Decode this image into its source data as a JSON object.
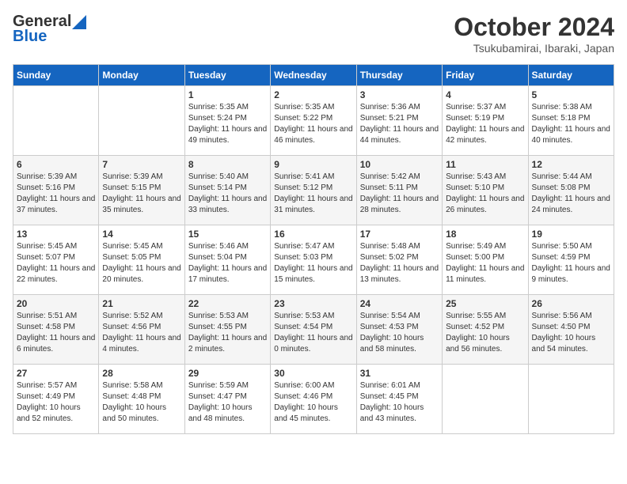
{
  "header": {
    "logo_general": "General",
    "logo_blue": "Blue",
    "month_title": "October 2024",
    "location": "Tsukubamirai, Ibaraki, Japan"
  },
  "days_of_week": [
    "Sunday",
    "Monday",
    "Tuesday",
    "Wednesday",
    "Thursday",
    "Friday",
    "Saturday"
  ],
  "weeks": [
    [
      {
        "day": "",
        "info": ""
      },
      {
        "day": "",
        "info": ""
      },
      {
        "day": "1",
        "info": "Sunrise: 5:35 AM\nSunset: 5:24 PM\nDaylight: 11 hours and 49 minutes."
      },
      {
        "day": "2",
        "info": "Sunrise: 5:35 AM\nSunset: 5:22 PM\nDaylight: 11 hours and 46 minutes."
      },
      {
        "day": "3",
        "info": "Sunrise: 5:36 AM\nSunset: 5:21 PM\nDaylight: 11 hours and 44 minutes."
      },
      {
        "day": "4",
        "info": "Sunrise: 5:37 AM\nSunset: 5:19 PM\nDaylight: 11 hours and 42 minutes."
      },
      {
        "day": "5",
        "info": "Sunrise: 5:38 AM\nSunset: 5:18 PM\nDaylight: 11 hours and 40 minutes."
      }
    ],
    [
      {
        "day": "6",
        "info": "Sunrise: 5:39 AM\nSunset: 5:16 PM\nDaylight: 11 hours and 37 minutes."
      },
      {
        "day": "7",
        "info": "Sunrise: 5:39 AM\nSunset: 5:15 PM\nDaylight: 11 hours and 35 minutes."
      },
      {
        "day": "8",
        "info": "Sunrise: 5:40 AM\nSunset: 5:14 PM\nDaylight: 11 hours and 33 minutes."
      },
      {
        "day": "9",
        "info": "Sunrise: 5:41 AM\nSunset: 5:12 PM\nDaylight: 11 hours and 31 minutes."
      },
      {
        "day": "10",
        "info": "Sunrise: 5:42 AM\nSunset: 5:11 PM\nDaylight: 11 hours and 28 minutes."
      },
      {
        "day": "11",
        "info": "Sunrise: 5:43 AM\nSunset: 5:10 PM\nDaylight: 11 hours and 26 minutes."
      },
      {
        "day": "12",
        "info": "Sunrise: 5:44 AM\nSunset: 5:08 PM\nDaylight: 11 hours and 24 minutes."
      }
    ],
    [
      {
        "day": "13",
        "info": "Sunrise: 5:45 AM\nSunset: 5:07 PM\nDaylight: 11 hours and 22 minutes."
      },
      {
        "day": "14",
        "info": "Sunrise: 5:45 AM\nSunset: 5:05 PM\nDaylight: 11 hours and 20 minutes."
      },
      {
        "day": "15",
        "info": "Sunrise: 5:46 AM\nSunset: 5:04 PM\nDaylight: 11 hours and 17 minutes."
      },
      {
        "day": "16",
        "info": "Sunrise: 5:47 AM\nSunset: 5:03 PM\nDaylight: 11 hours and 15 minutes."
      },
      {
        "day": "17",
        "info": "Sunrise: 5:48 AM\nSunset: 5:02 PM\nDaylight: 11 hours and 13 minutes."
      },
      {
        "day": "18",
        "info": "Sunrise: 5:49 AM\nSunset: 5:00 PM\nDaylight: 11 hours and 11 minutes."
      },
      {
        "day": "19",
        "info": "Sunrise: 5:50 AM\nSunset: 4:59 PM\nDaylight: 11 hours and 9 minutes."
      }
    ],
    [
      {
        "day": "20",
        "info": "Sunrise: 5:51 AM\nSunset: 4:58 PM\nDaylight: 11 hours and 6 minutes."
      },
      {
        "day": "21",
        "info": "Sunrise: 5:52 AM\nSunset: 4:56 PM\nDaylight: 11 hours and 4 minutes."
      },
      {
        "day": "22",
        "info": "Sunrise: 5:53 AM\nSunset: 4:55 PM\nDaylight: 11 hours and 2 minutes."
      },
      {
        "day": "23",
        "info": "Sunrise: 5:53 AM\nSunset: 4:54 PM\nDaylight: 11 hours and 0 minutes."
      },
      {
        "day": "24",
        "info": "Sunrise: 5:54 AM\nSunset: 4:53 PM\nDaylight: 10 hours and 58 minutes."
      },
      {
        "day": "25",
        "info": "Sunrise: 5:55 AM\nSunset: 4:52 PM\nDaylight: 10 hours and 56 minutes."
      },
      {
        "day": "26",
        "info": "Sunrise: 5:56 AM\nSunset: 4:50 PM\nDaylight: 10 hours and 54 minutes."
      }
    ],
    [
      {
        "day": "27",
        "info": "Sunrise: 5:57 AM\nSunset: 4:49 PM\nDaylight: 10 hours and 52 minutes."
      },
      {
        "day": "28",
        "info": "Sunrise: 5:58 AM\nSunset: 4:48 PM\nDaylight: 10 hours and 50 minutes."
      },
      {
        "day": "29",
        "info": "Sunrise: 5:59 AM\nSunset: 4:47 PM\nDaylight: 10 hours and 48 minutes."
      },
      {
        "day": "30",
        "info": "Sunrise: 6:00 AM\nSunset: 4:46 PM\nDaylight: 10 hours and 45 minutes."
      },
      {
        "day": "31",
        "info": "Sunrise: 6:01 AM\nSunset: 4:45 PM\nDaylight: 10 hours and 43 minutes."
      },
      {
        "day": "",
        "info": ""
      },
      {
        "day": "",
        "info": ""
      }
    ]
  ]
}
